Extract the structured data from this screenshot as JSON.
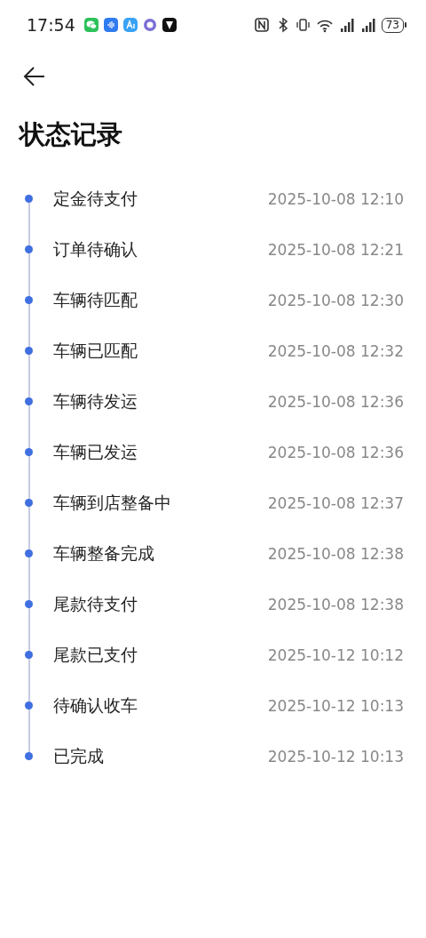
{
  "status_bar": {
    "time": "17:54",
    "battery": "73"
  },
  "title": "状态记录",
  "records": [
    {
      "label": "定金待支付",
      "time": "2025-10-08 12:10"
    },
    {
      "label": "订单待确认",
      "time": "2025-10-08 12:21"
    },
    {
      "label": "车辆待匹配",
      "time": "2025-10-08 12:30"
    },
    {
      "label": "车辆已匹配",
      "time": "2025-10-08 12:32"
    },
    {
      "label": "车辆待发运",
      "time": "2025-10-08 12:36"
    },
    {
      "label": "车辆已发运",
      "time": "2025-10-08 12:36"
    },
    {
      "label": "车辆到店整备中",
      "time": "2025-10-08 12:37"
    },
    {
      "label": "车辆整备完成",
      "time": "2025-10-08 12:38"
    },
    {
      "label": "尾款待支付",
      "time": "2025-10-08 12:38"
    },
    {
      "label": "尾款已支付",
      "time": "2025-10-12 10:12"
    },
    {
      "label": "待确认收车",
      "time": "2025-10-12 10:13"
    },
    {
      "label": "已完成",
      "time": "2025-10-12 10:13"
    }
  ]
}
